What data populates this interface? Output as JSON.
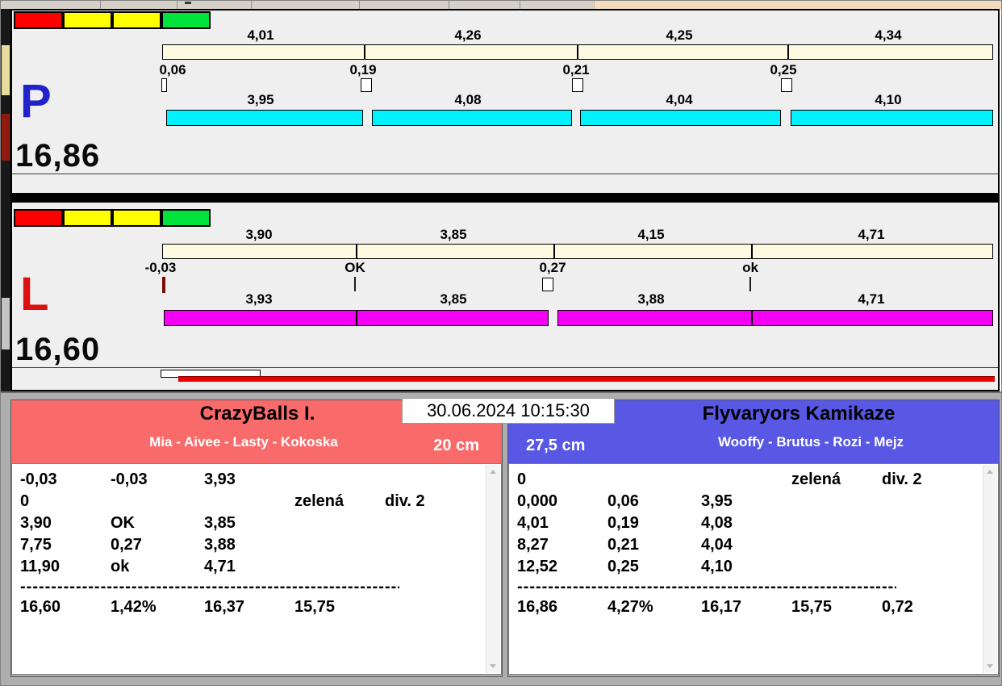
{
  "timestamp": "30.06.2024 10:15:30",
  "lanes": [
    {
      "letter": "P",
      "total": "16,86",
      "splits": [
        "4,01",
        "4,26",
        "4,25",
        "4,34"
      ],
      "losses": [
        "0,06",
        "0,19",
        "0,21",
        "0,25"
      ],
      "legs": [
        "3,95",
        "4,08",
        "4,04",
        "4,10"
      ]
    },
    {
      "letter": "L",
      "total": "16,60",
      "splits": [
        "3,90",
        "3,85",
        "4,15",
        "4,71"
      ],
      "losses": [
        "-0,03",
        "OK",
        "0,27",
        "ok"
      ],
      "legs": [
        "3,93",
        "3,85",
        "3,88",
        "4,71"
      ]
    }
  ],
  "colors": {
    "light_red": "#FF0000",
    "light_yellow": "#FFFF00",
    "light_green": "#00E23C",
    "p_bar": "#00F2FF",
    "l_bar": "#F400F4",
    "p_letter": "#2222CC",
    "l_letter": "#DD1111",
    "team_left_header": "#F96B6B",
    "team_right_header": "#5858E4"
  },
  "teams": {
    "left": {
      "name": "CrazyBalls I.",
      "lineup": "Mia - Aivee - Lasty - Kokoska",
      "height": "20 cm",
      "rows": [
        [
          "-0,03",
          "-0,03",
          "3,93",
          "",
          ""
        ],
        [
          "0",
          "",
          "",
          "zelená",
          "div. 2"
        ],
        [
          "3,90",
          "OK",
          "3,85",
          "",
          ""
        ],
        [
          "7,75",
          "0,27",
          "3,88",
          "",
          ""
        ],
        [
          "11,90",
          "ok",
          "4,71",
          "",
          ""
        ]
      ],
      "separator": "--------------------------------------------------------------------",
      "totals": [
        "16,60",
        "1,42%",
        "16,37",
        "15,75",
        ""
      ]
    },
    "right": {
      "name": "Flyvaryors Kamikaze",
      "lineup": "Wooffy - Brutus - Rozi - Mejz",
      "height": "27,5 cm",
      "rows": [
        [
          "0",
          "",
          "",
          "zelená",
          "div. 2"
        ],
        [
          "0,000",
          "0,06",
          "3,95",
          "",
          ""
        ],
        [
          "4,01",
          "0,19",
          "4,08",
          "",
          ""
        ],
        [
          "8,27",
          "0,21",
          "4,04",
          "",
          ""
        ],
        [
          "12,52",
          "0,25",
          "4,10",
          "",
          ""
        ]
      ],
      "separator": "------------------------------------------------------------------------",
      "totals": [
        "16,86",
        "4,27%",
        "16,17",
        "15,75",
        "0,72"
      ]
    }
  }
}
